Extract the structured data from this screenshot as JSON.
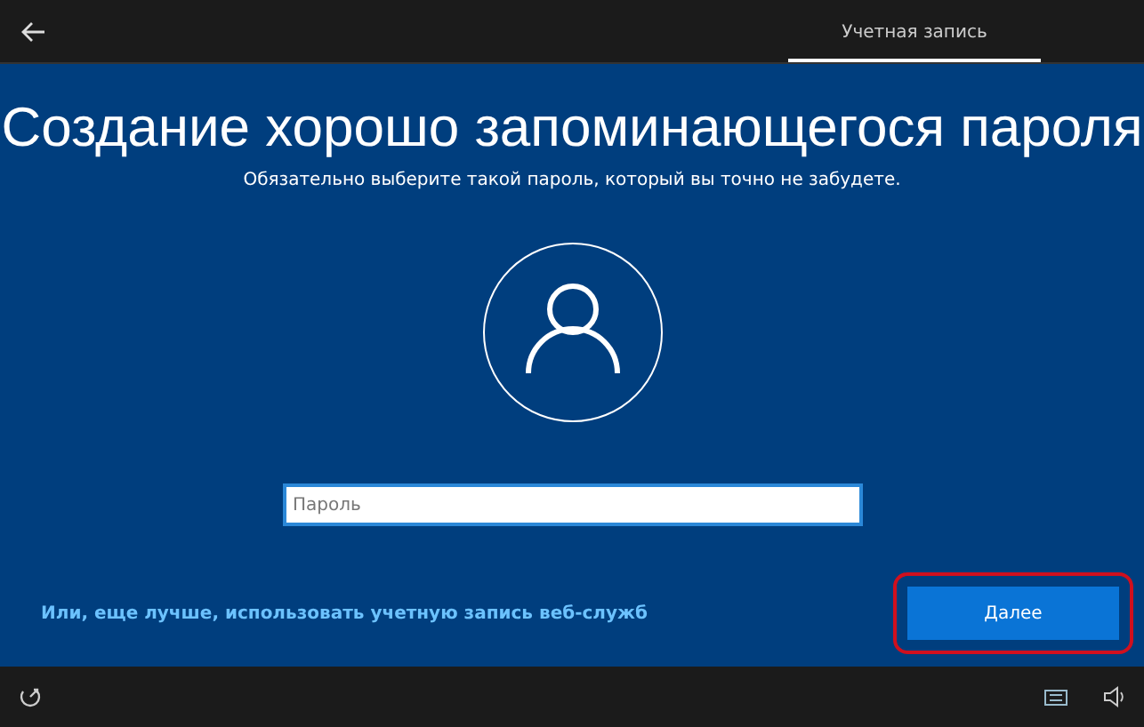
{
  "header": {
    "tabs": [
      {
        "label": "Учетная запись",
        "selected": true
      }
    ]
  },
  "title": "Создание хорошо запоминающегося пароля",
  "subtitle": "Обязательно выберите такой пароль, который вы точно не забудете.",
  "password_field": {
    "placeholder": "Пароль"
  },
  "link": "Или, еще лучше, использовать учетную запись веб-служб",
  "next_button": {
    "label": "Далее",
    "highlighted": true
  }
}
